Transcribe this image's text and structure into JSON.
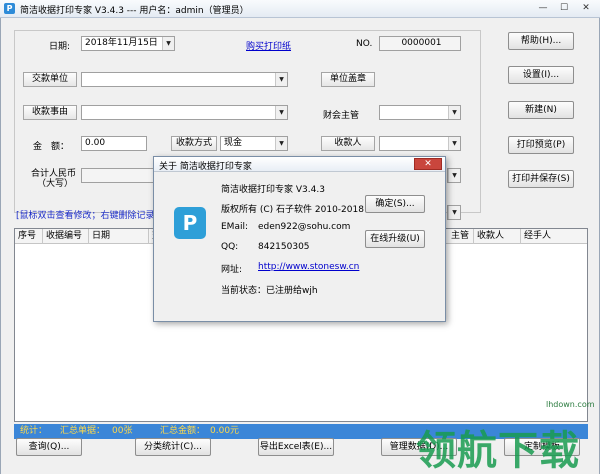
{
  "window": {
    "title": "简洁收据打印专家 V3.4.3 --- 用户名：admin（管理员）",
    "minimize": "—",
    "maximize": "☐",
    "close": "✕"
  },
  "form": {
    "date_label": "日期:",
    "date_value": "2018年11月15日",
    "buy_paper_link": "购买打印纸",
    "no_label": "NO.",
    "no_value": "0000001",
    "payer_label": "交款单位",
    "reason_label": "收款事由",
    "amount_label": "金　额：",
    "amount_value": "0.00",
    "pay_method_label": "收款方式",
    "pay_method_value": "现金",
    "total_rmb_label_1": "合计人民币",
    "total_rmb_label_2": "（大写）",
    "unit_seal_label": "单位盖章",
    "finance_label": "财会主管",
    "payee_label": "收款人"
  },
  "side_buttons": {
    "help": "帮助(H)...",
    "settings": "设置(I)...",
    "new": "新建(N)",
    "print_preview": "打印预览(P)",
    "print_save": "打印并保存(S)"
  },
  "hint": "[鼠标双击查看修改；右键删除记录",
  "table": {
    "columns": [
      "序号",
      "收据编号",
      "日期",
      "交",
      "主管",
      "收款人",
      "经手人"
    ]
  },
  "status": {
    "stats_label": "统计：",
    "count_label": "汇总单据：",
    "count_value": "00张",
    "sum_label": "汇总金额：",
    "sum_value": "0.00元"
  },
  "bottom_buttons": {
    "query": "查询(Q)...",
    "category_stats": "分类统计(C)...",
    "export_excel": "导出Excel表(E)...",
    "manage_data": "管理数据(D)...",
    "custom_template": "定制模板"
  },
  "about_dialog": {
    "title": "关于 简洁收据打印专家",
    "close": "✕",
    "logo": "P",
    "product": "简洁收据打印专家 V3.4.3",
    "copyright": "版权所有 (C) 石子软件 2010-2018",
    "email_label": "EMail:",
    "email_value": "eden922@sohu.com",
    "qq_label": "QQ:",
    "qq_value": "842150305",
    "site_label": "网址:",
    "site_value": "http://www.stonesw.cn",
    "status_text": "当前状态：已注册给wjh",
    "ok_button": "确定(S)...",
    "upgrade_button": "在线升级(U)"
  },
  "watermark": {
    "text": "领航下载",
    "small": "lhdown.com"
  }
}
